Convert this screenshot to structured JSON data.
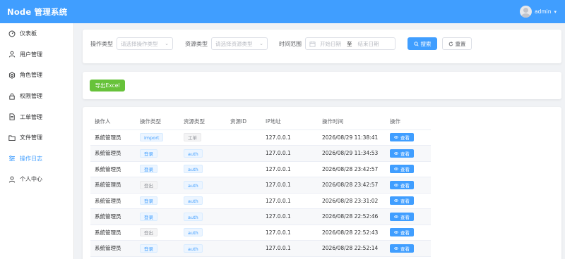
{
  "header": {
    "app_title": "Node 管理系统",
    "username": "admin",
    "caret": "▾"
  },
  "colors": {
    "primary": "#409eff",
    "success": "#67c23a",
    "bg": "#f0f2f5"
  },
  "sidebar": {
    "items": [
      {
        "label": "仪表板",
        "icon": "dashboard-icon"
      },
      {
        "label": "用户管理",
        "icon": "user-icon"
      },
      {
        "label": "角色管理",
        "icon": "gear-icon"
      },
      {
        "label": "权限管理",
        "icon": "lock-icon"
      },
      {
        "label": "工单管理",
        "icon": "document-icon"
      },
      {
        "label": "文件管理",
        "icon": "folder-icon"
      },
      {
        "label": "操作日志",
        "icon": "sliders-icon",
        "active": true
      },
      {
        "label": "个人中心",
        "icon": "user-icon"
      }
    ]
  },
  "search": {
    "op_type_label": "操作类型",
    "op_type_placeholder": "请选择操作类型",
    "res_type_label": "资源类型",
    "res_type_placeholder": "请选择资源类型",
    "time_label": "时间范围",
    "start_placeholder": "开始日期",
    "range_sep": "至",
    "end_placeholder": "结束日期",
    "search_btn": "搜索",
    "reset_btn": "重置"
  },
  "export": {
    "label": "导出Excel"
  },
  "table": {
    "columns": [
      "操作人",
      "操作类型",
      "资源类型",
      "资源ID",
      "IP地址",
      "操作时间",
      "操作"
    ],
    "view_label": "查看",
    "rows": [
      {
        "user": "系统管理员",
        "op": "import",
        "op_style": "primary",
        "res": "工单",
        "res_style": "info",
        "res_id": "",
        "ip": "127.0.0.1",
        "time": "2026/08/29 11:38:41"
      },
      {
        "user": "系统管理员",
        "op": "登录",
        "op_style": "primary",
        "res": "auth",
        "res_style": "primary",
        "res_id": "",
        "ip": "127.0.0.1",
        "time": "2026/08/29 11:34:53"
      },
      {
        "user": "系统管理员",
        "op": "登录",
        "op_style": "primary",
        "res": "auth",
        "res_style": "primary",
        "res_id": "",
        "ip": "127.0.0.1",
        "time": "2026/08/28 23:42:57"
      },
      {
        "user": "系统管理员",
        "op": "登出",
        "op_style": "info",
        "res": "auth",
        "res_style": "primary",
        "res_id": "",
        "ip": "127.0.0.1",
        "time": "2026/08/28 23:42:57"
      },
      {
        "user": "系统管理员",
        "op": "登录",
        "op_style": "primary",
        "res": "auth",
        "res_style": "primary",
        "res_id": "",
        "ip": "127.0.0.1",
        "time": "2026/08/28 23:31:02"
      },
      {
        "user": "系统管理员",
        "op": "登录",
        "op_style": "primary",
        "res": "auth",
        "res_style": "primary",
        "res_id": "",
        "ip": "127.0.0.1",
        "time": "2026/08/28 22:52:46"
      },
      {
        "user": "系统管理员",
        "op": "登出",
        "op_style": "info",
        "res": "auth",
        "res_style": "primary",
        "res_id": "",
        "ip": "127.0.0.1",
        "time": "2026/08/28 22:52:43"
      },
      {
        "user": "系统管理员",
        "op": "登录",
        "op_style": "primary",
        "res": "auth",
        "res_style": "primary",
        "res_id": "",
        "ip": "127.0.0.1",
        "time": "2026/08/28 22:52:14"
      }
    ]
  }
}
